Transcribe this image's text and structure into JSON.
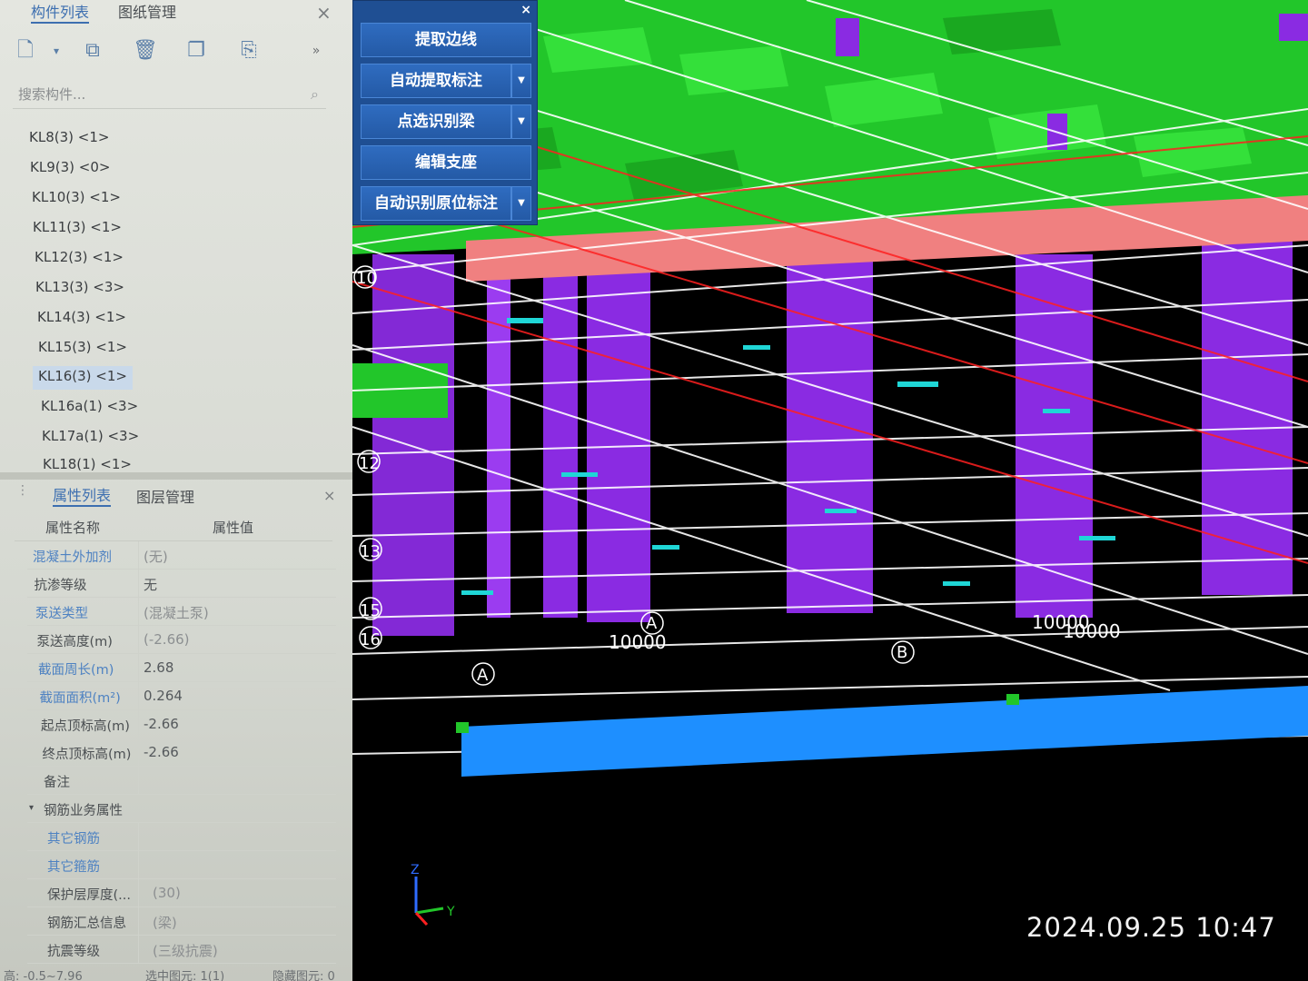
{
  "component_panel": {
    "tabs": [
      "构件列表",
      "图纸管理"
    ],
    "search_placeholder": "搜索构件...",
    "items": [
      "KL8(3) <1>",
      "KL9(3) <0>",
      "KL10(3) <1>",
      "KL11(3) <1>",
      "KL12(3) <1>",
      "KL13(3) <3>",
      "KL14(3) <1>",
      "KL15(3) <1>",
      "KL16(3) <1>",
      "KL16a(1) <3>",
      "KL17a(1) <3>",
      "KL18(1) <1>"
    ],
    "selected_index": 8
  },
  "property_panel": {
    "tabs": [
      "属性列表",
      "图层管理"
    ],
    "headers": [
      "属性名称",
      "属性值"
    ],
    "rows": [
      {
        "name": "混凝土外加剂",
        "value": "(无)",
        "blue": true
      },
      {
        "name": "抗渗等级",
        "value": "无",
        "blue": false
      },
      {
        "name": "泵送类型",
        "value": "(混凝土泵)",
        "blue": true
      },
      {
        "name": "泵送高度(m)",
        "value": "(-2.66)",
        "blue": false
      },
      {
        "name": "截面周长(m)",
        "value": "2.68",
        "blue": true
      },
      {
        "name": "截面面积(m²)",
        "value": "0.264",
        "blue": true
      },
      {
        "name": "起点顶标高(m)",
        "value": "-2.66",
        "blue": false
      },
      {
        "name": "终点顶标高(m)",
        "value": "-2.66",
        "blue": false
      },
      {
        "name": "备注",
        "value": "",
        "blue": false
      },
      {
        "name": "钢筋业务属性",
        "value": "",
        "blue": false,
        "group": true
      },
      {
        "name": "其它钢筋",
        "value": "",
        "blue": true
      },
      {
        "name": "其它箍筋",
        "value": "",
        "blue": true
      },
      {
        "name": "保护层厚度(...",
        "value": "(30)",
        "blue": false
      },
      {
        "name": "钢筋汇总信息",
        "value": "(梁)",
        "blue": false
      },
      {
        "name": "抗震等级",
        "value": "(三级抗震)",
        "blue": false
      }
    ]
  },
  "status_bar": {
    "elevation": "高: -0.5~7.96",
    "selected": "选中图元: 1(1)",
    "hidden": "隐藏图元: 0"
  },
  "float_menu": {
    "buttons": [
      {
        "label": "提取边线",
        "dropdown": false
      },
      {
        "label": "自动提取标注",
        "dropdown": true
      },
      {
        "label": "点选识别梁",
        "dropdown": true
      },
      {
        "label": "编辑支座",
        "dropdown": false
      },
      {
        "label": "自动识别原位标注",
        "dropdown": true
      }
    ]
  },
  "viewport": {
    "axis_labels": [
      "10",
      "12",
      "13",
      "15",
      "16",
      "A",
      "B",
      "A"
    ],
    "dimension_labels": [
      "10000",
      "10000",
      "10000"
    ],
    "axis_triad": [
      "Z",
      "Y"
    ],
    "timestamp": "2024.09.25  10:47",
    "colors": {
      "slab": "#27d12b",
      "column": "#8a2be2",
      "beam_top": "#f08080",
      "beam_bottom": "#1e8fff",
      "grid": "#ffffff",
      "rebar": "#ff2020"
    }
  }
}
